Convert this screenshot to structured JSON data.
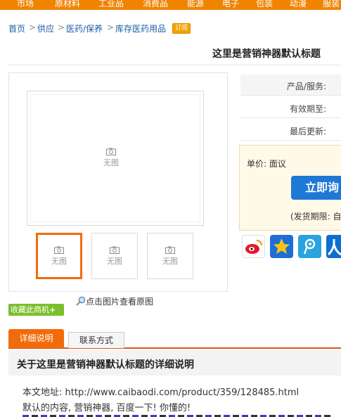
{
  "top_nav": {
    "items": [
      "市场",
      "原材料",
      "工业品",
      "消费品",
      "能源",
      "电子",
      "包装",
      "动漫",
      "服装"
    ]
  },
  "breadcrumb": {
    "items": [
      "首页",
      "供应",
      "医药/保养",
      "库存医药用品"
    ],
    "separator": ">",
    "subscribe_label": "订阅"
  },
  "page_title": "这里是营销神器默认标题",
  "gallery": {
    "no_image_text": "无图",
    "thumbnails": [
      "无图",
      "无图",
      "无图"
    ],
    "zoom_hint": "点击图片查看原图"
  },
  "favorite_button": "收藏此商机",
  "info": {
    "rows": [
      "产品/服务:",
      "有效期至:",
      "最后更新:"
    ]
  },
  "price": {
    "label": "单价: 面议",
    "buy_button": "立即询",
    "delivery": "(发货期限: 自"
  },
  "share_icons": [
    "weibo-icon",
    "qzone-icon",
    "tencent-weibo-icon",
    "renren-icon"
  ],
  "tabs": {
    "active": "详细说明",
    "second": "联系方式"
  },
  "section_title": "关于这里是营销神器默认标题的详细说明",
  "article": {
    "url_line": "本文地址: http://www.caibaodi.com/product/359/128485.html",
    "content_line": "默认的内容, 营销神器, 百度一下! 你懂的!"
  },
  "colors": {
    "accent": "#f26b0a",
    "link": "#1a5fa8",
    "button_blue": "#1e78d6",
    "green": "#7cbf2c"
  }
}
